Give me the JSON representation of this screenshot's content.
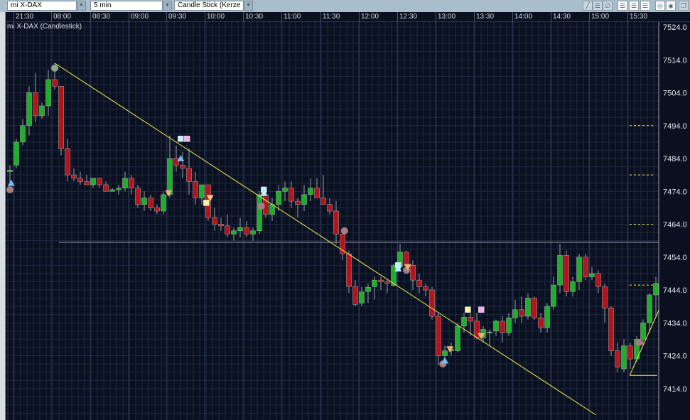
{
  "toolbar": {
    "symbol": "mi X-DAX",
    "interval": "5 min",
    "chart_type": "Candle Stick (Kerze",
    "icons": [
      "draw-line-icon",
      "horizontal-lines-icon",
      "no-draw-icon",
      "grid-lines-1-icon",
      "grid-lines-2-icon",
      "grid-lines-3-icon",
      "color-circle-icon",
      "pattern-circle-icon",
      "window-restore-icon"
    ]
  },
  "chart_title": "mi X-DAX (Candlestick)",
  "colors": {
    "up": "#1fae2a",
    "down": "#b4141c",
    "trend": "#f2f24a",
    "bg": "#0a1020",
    "grid": "#1e2a42"
  },
  "chart_data": {
    "type": "candlestick",
    "time_labels": [
      "21:30",
      "08:00",
      "08:30",
      "09:00",
      "09:30",
      "10:00",
      "10:30",
      "11:00",
      "11:30",
      "12:00",
      "12:30",
      "13:00",
      "13:30",
      "14:00",
      "14:30",
      "15:00",
      "15:30"
    ],
    "price_labels": [
      "7524.0",
      "7514.0",
      "7504.0",
      "7494.0",
      "7484.0",
      "7474.0",
      "7464.0",
      "7454.0",
      "7444.0",
      "7434.0",
      "7424.0",
      "7414.0"
    ],
    "ylim": [
      7414,
      7524
    ],
    "ohlc": [
      [
        7480,
        7482,
        7476,
        7480.5
      ],
      [
        7482,
        7490,
        7481,
        7489
      ],
      [
        7489,
        7496,
        7488,
        7494
      ],
      [
        7494,
        7506,
        7491,
        7504
      ],
      [
        7504,
        7510,
        7495,
        7497
      ],
      [
        7497,
        7501,
        7496,
        7500
      ],
      [
        7500,
        7511,
        7497,
        7508
      ],
      [
        7508,
        7513,
        7505,
        7506
      ],
      [
        7506,
        7506,
        7485,
        7487
      ],
      [
        7487,
        7490,
        7477,
        7479
      ],
      [
        7479,
        7481,
        7477,
        7478
      ],
      [
        7478,
        7480,
        7476,
        7477
      ],
      [
        7477,
        7479,
        7476,
        7476
      ],
      [
        7476,
        7478,
        7475,
        7478
      ],
      [
        7478,
        7478,
        7475,
        7476
      ],
      [
        7476,
        7477,
        7474,
        7474
      ],
      [
        7474,
        7475,
        7474,
        7474.5
      ],
      [
        7474.5,
        7476,
        7473,
        7475
      ],
      [
        7475,
        7480,
        7474,
        7478
      ],
      [
        7478,
        7479,
        7473,
        7475
      ],
      [
        7475,
        7476,
        7469,
        7470
      ],
      [
        7470,
        7474,
        7468,
        7472
      ],
      [
        7472,
        7473,
        7468,
        7469
      ],
      [
        7469,
        7470,
        7467,
        7468
      ],
      [
        7468,
        7474,
        7467,
        7473
      ],
      [
        7473,
        7491,
        7472,
        7484
      ],
      [
        7484,
        7488,
        7480,
        7482
      ],
      [
        7482,
        7486,
        7478,
        7481
      ],
      [
        7481,
        7487,
        7473,
        7477
      ],
      [
        7477,
        7480,
        7470,
        7472
      ],
      [
        7472,
        7475,
        7470,
        7476
      ],
      [
        7476,
        7476,
        7465,
        7466
      ],
      [
        7466,
        7469,
        7462,
        7464
      ],
      [
        7464,
        7466,
        7462,
        7463.5
      ],
      [
        7463.5,
        7467,
        7460,
        7461
      ],
      [
        7461,
        7463,
        7459,
        7462
      ],
      [
        7462,
        7466,
        7460,
        7463
      ],
      [
        7463,
        7465,
        7460,
        7461
      ],
      [
        7461,
        7463,
        7459,
        7462
      ],
      [
        7462,
        7474,
        7461,
        7473
      ],
      [
        7473,
        7475,
        7466,
        7467
      ],
      [
        7467,
        7472,
        7465,
        7470
      ],
      [
        7470,
        7476,
        7468,
        7474
      ],
      [
        7474,
        7477,
        7471,
        7475
      ],
      [
        7475,
        7477,
        7469,
        7471
      ],
      [
        7471,
        7472,
        7466,
        7470
      ],
      [
        7470,
        7476,
        7468,
        7473
      ],
      [
        7473,
        7478,
        7471,
        7475
      ],
      [
        7475,
        7478,
        7472,
        7472
      ],
      [
        7472,
        7479,
        7470,
        7470
      ],
      [
        7470,
        7472,
        7467,
        7468
      ],
      [
        7468,
        7471,
        7458,
        7461
      ],
      [
        7461,
        7462,
        7453,
        7455
      ],
      [
        7455,
        7456,
        7443,
        7445
      ],
      [
        7445,
        7447,
        7439,
        7439.6
      ],
      [
        7440,
        7445,
        7439,
        7443.4
      ],
      [
        7443.5,
        7446,
        7440,
        7444.8
      ],
      [
        7445,
        7448,
        7441,
        7447
      ],
      [
        7447,
        7448,
        7444,
        7446.5
      ],
      [
        7446.5,
        7447,
        7443,
        7446
      ],
      [
        7445.4,
        7452,
        7445,
        7451.4
      ],
      [
        7451,
        7458,
        7450,
        7455.5
      ],
      [
        7455.5,
        7456,
        7450,
        7451.5
      ],
      [
        7451.5,
        7453,
        7444,
        7447
      ],
      [
        7447,
        7449,
        7443,
        7445
      ],
      [
        7445,
        7446,
        7442,
        7444
      ],
      [
        7444,
        7445,
        7435,
        7436
      ],
      [
        7436,
        7437,
        7421,
        7424
      ],
      [
        7424,
        7427,
        7423,
        7425.5
      ],
      [
        7425.5,
        7428,
        7424,
        7426
      ],
      [
        7425.5,
        7434,
        7425,
        7433
      ],
      [
        7433,
        7437,
        7431,
        7435.7
      ],
      [
        7435.7,
        7437,
        7430,
        7434.5
      ],
      [
        7434.5,
        7437,
        7429,
        7429.5
      ],
      [
        7429.5,
        7433,
        7428,
        7432
      ],
      [
        7431,
        7432,
        7427,
        7431.2
      ],
      [
        7431.5,
        7435,
        7430,
        7434.5
      ],
      [
        7434.5,
        7436,
        7428,
        7431
      ],
      [
        7431,
        7437,
        7430,
        7435.5
      ],
      [
        7435.5,
        7441,
        7434,
        7438
      ],
      [
        7438,
        7442,
        7434,
        7436
      ],
      [
        7436,
        7443,
        7435,
        7441.5
      ],
      [
        7441.5,
        7442,
        7435,
        7435.5
      ],
      [
        7435.5,
        7437,
        7431,
        7432.5
      ],
      [
        7432.5,
        7440,
        7431,
        7439
      ],
      [
        7439,
        7448,
        7438,
        7445.5
      ],
      [
        7445.5,
        7458,
        7443,
        7454.5
      ],
      [
        7454.5,
        7456,
        7442,
        7443.5
      ],
      [
        7443.5,
        7448,
        7442,
        7446.5
      ],
      [
        7446.5,
        7455,
        7444,
        7454
      ],
      [
        7454,
        7455,
        7447,
        7448
      ],
      [
        7448,
        7451,
        7447,
        7449
      ],
      [
        7449,
        7450,
        7443,
        7445
      ],
      [
        7445,
        7446,
        7434,
        7438.5
      ],
      [
        7438.5,
        7439,
        7424,
        7425.5
      ],
      [
        7425.5,
        7428,
        7419,
        7420.5
      ],
      [
        7420,
        7429,
        7419,
        7427
      ],
      [
        7427,
        7428,
        7420,
        7423
      ],
      [
        7423,
        7430,
        7422,
        7429
      ],
      [
        7429,
        7435,
        7427,
        7434
      ],
      [
        7434,
        7443,
        7431,
        7442.5
      ],
      [
        7442.5,
        7448,
        7436,
        7446
      ]
    ],
    "markers": [
      {
        "type": "circle",
        "i": 0,
        "p": 7474.5,
        "color": "#a87c80"
      },
      {
        "type": "tri-up",
        "i": 0.2,
        "p": 7476.5,
        "color": "#7ab8f0"
      },
      {
        "type": "circle",
        "i": 7,
        "p": 7511.5,
        "color": "#8aa88a"
      },
      {
        "type": "square",
        "i": 26.7,
        "p": 7490,
        "color": "#bff0ff"
      },
      {
        "type": "square",
        "i": 27.7,
        "p": 7490,
        "color": "#f5b0e8"
      },
      {
        "type": "tri-up",
        "i": 26.7,
        "p": 7484,
        "color": "#7ab8f0"
      },
      {
        "type": "tri-down",
        "i": 24.8,
        "p": 7473.5,
        "color": "#f0b070"
      },
      {
        "type": "square",
        "i": 30.7,
        "p": 7470.5,
        "color": "#fff0a0"
      },
      {
        "type": "tri-down",
        "i": 31.3,
        "p": 7472,
        "color": "#f0c890"
      },
      {
        "type": "square",
        "i": 39.7,
        "p": 7474.5,
        "color": "#bff0ff"
      },
      {
        "type": "tri-up",
        "i": 39.7,
        "p": 7473.5,
        "color": "#bff0ff"
      },
      {
        "type": "circle",
        "i": 39.3,
        "p": 7469.5,
        "color": "#a87c80"
      },
      {
        "type": "circle",
        "i": 52.3,
        "p": 7462,
        "color": "#a87c80"
      },
      {
        "type": "square",
        "i": 60.7,
        "p": 7451.5,
        "color": "#bff0ff"
      },
      {
        "type": "tri-up",
        "i": 60.7,
        "p": 7450.5,
        "color": "#bff0ff"
      },
      {
        "type": "circle",
        "i": 62,
        "p": 7450,
        "color": "#a87c80"
      },
      {
        "type": "tri-down",
        "i": 62.2,
        "p": 7451,
        "color": "#f0b070"
      },
      {
        "type": "square",
        "i": 71.6,
        "p": 7438,
        "color": "#fff0a0"
      },
      {
        "type": "square",
        "i": 73.7,
        "p": 7438,
        "color": "#f5b0e8"
      },
      {
        "type": "tri-down",
        "i": 68.8,
        "p": 7426,
        "color": "#f0b070"
      },
      {
        "type": "circle",
        "i": 67.7,
        "p": 7421.5,
        "color": "#a87c80"
      },
      {
        "type": "tri-up",
        "i": 68,
        "p": 7422.5,
        "color": "#7ab8f0"
      },
      {
        "type": "tri-down",
        "i": 73.7,
        "p": 7430,
        "color": "#f0b070"
      },
      {
        "type": "circle",
        "i": 98.4,
        "p": 7428,
        "color": "#a87c80"
      }
    ],
    "trendline": {
      "from": {
        "i": 7,
        "p": 7513
      },
      "to": {
        "i": 91.6,
        "p": 7406
      }
    },
    "hline": {
      "p": 7458.5,
      "from_i": 7.7
    },
    "dashed_levels": [
      7494,
      7479,
      7464,
      7445.5
    ],
    "up_line": {
      "from": {
        "i": 96.9,
        "p": 7418
      },
      "to": {
        "i": 101.5,
        "p": 7438
      }
    },
    "flat_line": {
      "p": 7418
    }
  }
}
